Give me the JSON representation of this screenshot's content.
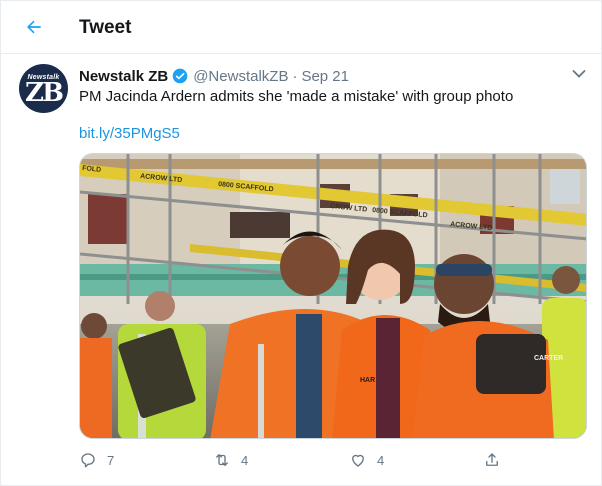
{
  "header": {
    "title": "Tweet"
  },
  "author": {
    "avatar_small_text": "Newstalk",
    "avatar_big_text": "ZB",
    "name": "Newstalk ZB",
    "handle": "@NewstalkZB",
    "separator": "·",
    "date": "Sep 21"
  },
  "tweet": {
    "text": "PM Jacinda Ardern admits she 'made a mistake' with group photo",
    "link": "bit.ly/35PMgS5"
  },
  "media": {
    "signs": [
      "ACROW LTD",
      "0800 SCAFFOLD",
      "CROW LTD",
      "0800 SCAFFOLD",
      "ACROW LTD",
      "FOLD"
    ],
    "vest_text": [
      "CARTER",
      "HAR"
    ]
  },
  "actions": {
    "reply_count": "7",
    "retweet_count": "4",
    "like_count": "4"
  },
  "colors": {
    "accent": "#1da1f2",
    "link": "#1b95e0",
    "muted": "#657786",
    "border": "#e6ecf0",
    "hi_vis_orange": "#f06a1e",
    "hi_vis_yellow": "#c8e63a"
  }
}
